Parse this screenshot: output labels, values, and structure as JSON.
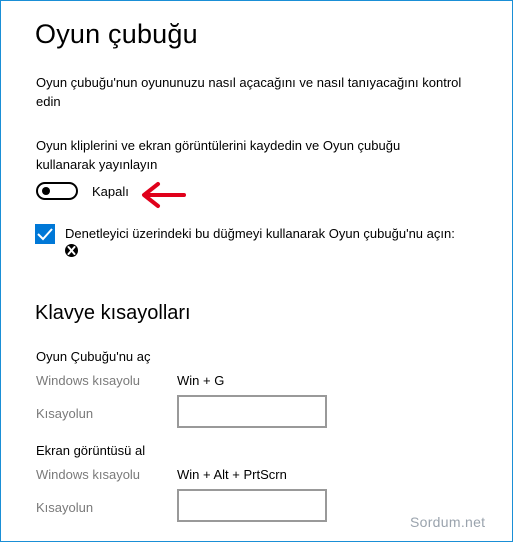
{
  "page": {
    "title": "Oyun çubuğu",
    "description": "Oyun çubuğu'nun oyununuzu nasıl açacağını ve nasıl tanıyacağını kontrol edin"
  },
  "record": {
    "description": "Oyun kliplerini ve ekran görüntülerini kaydedin ve Oyun çubuğu kullanarak yayınlayın",
    "toggle_state": "Kapalı",
    "toggle_on": false
  },
  "controller": {
    "checked": true,
    "label": "Denetleyici üzerindeki bu düğmeyi kullanarak Oyun çubuğu'nu açın:"
  },
  "shortcuts": {
    "title": "Klavye kısayolları",
    "open_bar": {
      "heading": "Oyun Çubuğu'nu aç",
      "windows_label": "Windows kısayolu",
      "windows_value": "Win + G",
      "custom_label": "Kısayolun",
      "custom_value": ""
    },
    "screenshot": {
      "heading": "Ekran görüntüsü al",
      "windows_label": "Windows kısayolu",
      "windows_value": "Win + Alt + PrtScrn",
      "custom_label": "Kısayolun",
      "custom_value": ""
    }
  },
  "watermark": "Sordum.net",
  "colors": {
    "accent": "#0078d7",
    "arrow": "#e0001b",
    "border": "#1a8fd6"
  }
}
